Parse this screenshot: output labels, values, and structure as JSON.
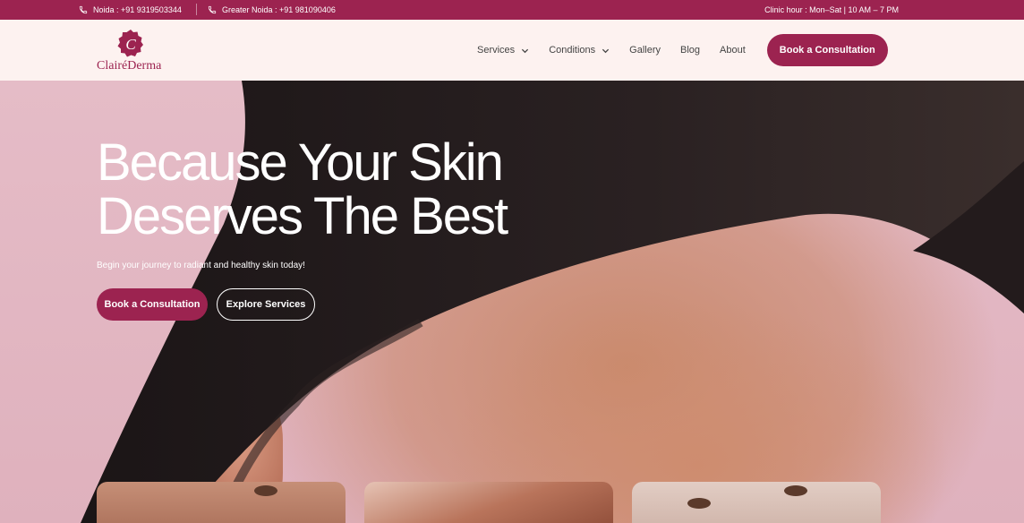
{
  "topbar": {
    "contact_noida": "Noida :  +91 9319503344",
    "contact_greater_noida": "Greater Noida :  +91 981090406",
    "hours": "Clinic hour : Mon–Sat | 10 AM – 7 PM"
  },
  "brand": {
    "name": "ClairéDerma",
    "monogram": "C"
  },
  "nav": {
    "services": "Services",
    "conditions": "Conditions",
    "gallery": "Gallery",
    "blog": "Blog",
    "about": "About",
    "cta": "Book a Consultation"
  },
  "hero": {
    "title_line1": "Because Your Skin",
    "title_line2": "Deserves The Best",
    "subtitle": "Begin your journey to radiant and healthy skin today!",
    "primary_button": "Book a Consultation",
    "secondary_button": "Explore Services"
  },
  "colors": {
    "brand": "#9c2350",
    "header_bg": "#fdf2f0",
    "hero_bg": "#e5bcc7"
  },
  "icons": {
    "phone": "phone-icon",
    "chevron": "chevron-down-icon"
  }
}
